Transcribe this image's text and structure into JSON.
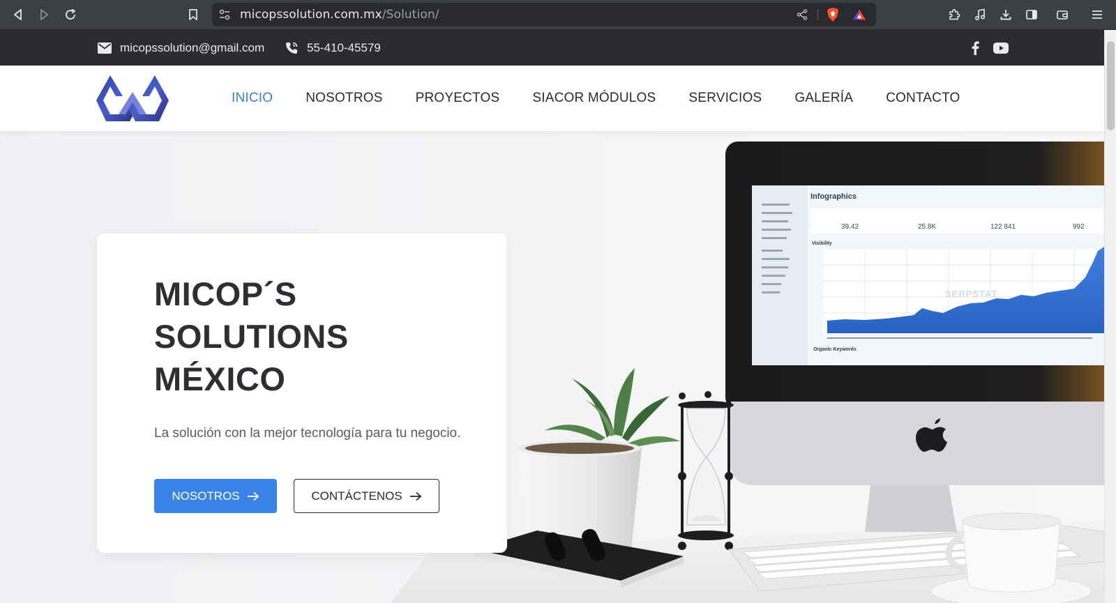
{
  "browser": {
    "url_domain": "micopssolution.com.mx",
    "url_path": "/Solution/",
    "icons": [
      "back-icon",
      "forward-icon",
      "reload-icon",
      "bookmark-icon",
      "site-settings-icon",
      "share-icon",
      "brave-shield-icon",
      "brave-rewards-icon",
      "extensions-icon",
      "media-icon",
      "downloads-icon",
      "sidebar-icon",
      "wallet-icon",
      "menu-icon"
    ]
  },
  "topbar": {
    "email": "micopssolution@gmail.com",
    "phone": "55-410-45579",
    "social": [
      "facebook-icon",
      "youtube-icon"
    ]
  },
  "nav": {
    "items": [
      {
        "label": "INICIO",
        "active": true
      },
      {
        "label": "NOSOTROS",
        "active": false
      },
      {
        "label": "PROYECTOS",
        "active": false
      },
      {
        "label": "SIACOR MÓDULOS",
        "active": false
      },
      {
        "label": "SERVICIOS",
        "active": false
      },
      {
        "label": "GALERÍA",
        "active": false
      },
      {
        "label": "CONTACTO",
        "active": false
      }
    ]
  },
  "hero": {
    "title_line1": "MICOP´S",
    "title_line2": "SOLUTIONS",
    "title_line3": "MÉXICO",
    "subtitle": "La solución con la mejor tecnología para tu negocio.",
    "primary_button": "NOSOTROS",
    "secondary_button": "CONTÁCTENOS",
    "screen": {
      "title": "Infographics",
      "section_label": "Visibility",
      "footer_label": "Organic Keywords",
      "watermark": "SERPSTAT",
      "stats": [
        "39.42",
        "25.8K",
        "122 841",
        "992"
      ]
    }
  },
  "colors": {
    "accent": "#3a83e6",
    "active_nav": "#3b7fd1",
    "topbar_bg": "#2c2c30",
    "chrome_bg": "#3c4043"
  }
}
